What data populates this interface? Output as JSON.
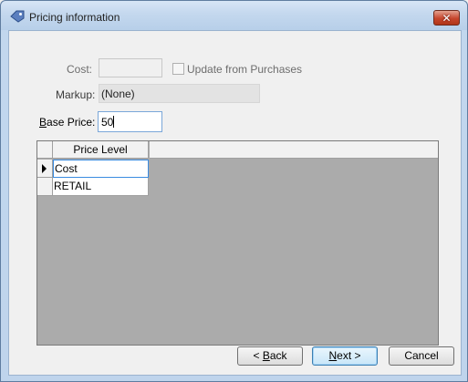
{
  "window": {
    "title": "Pricing information",
    "close_glyph": "✕"
  },
  "form": {
    "cost_label": "Cost:",
    "cost_value": "",
    "update_checkbox_label": "Update from Purchases",
    "update_checked": false,
    "markup_label": "Markup:",
    "markup_value": "(None)",
    "base_price_label_prefix": "B",
    "base_price_label_rest": "ase Price:",
    "base_price_value": "50"
  },
  "grid": {
    "column_header": "Price Level",
    "rows": [
      {
        "label": "Cost",
        "current": true
      },
      {
        "label": "RETAIL",
        "current": false
      }
    ]
  },
  "buttons": {
    "back_prefix": "< ",
    "back_mnemonic": "B",
    "back_rest": "ack",
    "next_mnemonic": "N",
    "next_rest": "ext >",
    "cancel_label": "Cancel"
  },
  "icons": {
    "title_icon": "price-tag-icon",
    "row_indicator": "current-row-arrow-icon"
  }
}
